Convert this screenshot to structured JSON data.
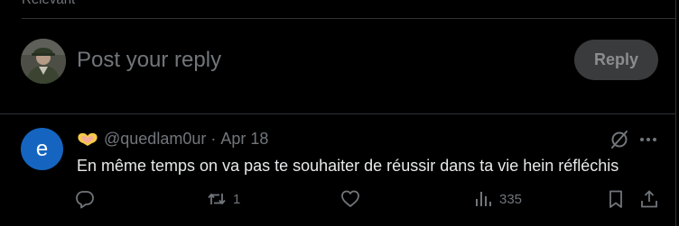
{
  "thread": {
    "sort_label": "Relevant"
  },
  "composer": {
    "placeholder": "Post your reply",
    "reply_button": "Reply"
  },
  "post": {
    "avatar_letter": "e",
    "avatar_color": "#1565c0",
    "handle": "@quedlam0ur",
    "separator": "·",
    "date": "Apr 18",
    "text": "En même temps on va pas te souhaiter de réussir dans ta vie hein réfléchis",
    "reposts": "1",
    "views": "335",
    "icons": {
      "display_name": "heart-hands-emoji-icon",
      "grok": "grok-icon",
      "more": "more-icon",
      "reply": "reply-icon",
      "repost": "repost-icon",
      "like": "heart-icon",
      "views": "views-icon",
      "bookmark": "bookmark-icon",
      "share": "share-icon"
    }
  },
  "colors": {
    "background": "#000000",
    "text": "#e7e9ea",
    "muted": "#71767b",
    "divider": "#2f3336",
    "reply_button_bg": "#3a3b3d"
  }
}
